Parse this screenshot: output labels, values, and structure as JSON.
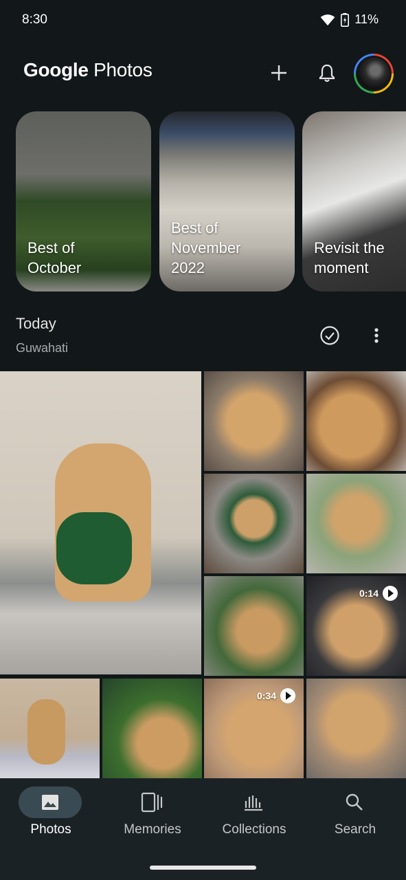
{
  "status_bar": {
    "time": "8:30",
    "battery": "11%"
  },
  "header": {
    "logo_google": "Google",
    "logo_photos": "Photos"
  },
  "memories": [
    {
      "label": "Best of\nOctober"
    },
    {
      "label": "Best of\nNovember\n2022"
    },
    {
      "label": "Revisit the\nmoment"
    }
  ],
  "section": {
    "title": "Today",
    "location": "Guwahati"
  },
  "photos": [
    {
      "kind": "photo"
    },
    {
      "kind": "photo"
    },
    {
      "kind": "photo"
    },
    {
      "kind": "photo"
    },
    {
      "kind": "photo"
    },
    {
      "kind": "photo"
    },
    {
      "kind": "video",
      "duration": "0:14"
    },
    {
      "kind": "photo"
    },
    {
      "kind": "photo"
    },
    {
      "kind": "video",
      "duration": "0:34"
    },
    {
      "kind": "photo"
    }
  ],
  "nav": {
    "photos": "Photos",
    "memories": "Memories",
    "collections": "Collections",
    "search": "Search"
  },
  "colors": {
    "background": "#121719",
    "nav_background": "#1b2226",
    "active_pill": "#3a4a52"
  },
  "icons": [
    "wifi-icon",
    "battery-icon",
    "add-icon",
    "bell-icon",
    "avatar",
    "check-circle-icon",
    "more-vert-icon",
    "photo-icon",
    "memories-icon",
    "collections-icon",
    "search-icon",
    "play-icon"
  ]
}
